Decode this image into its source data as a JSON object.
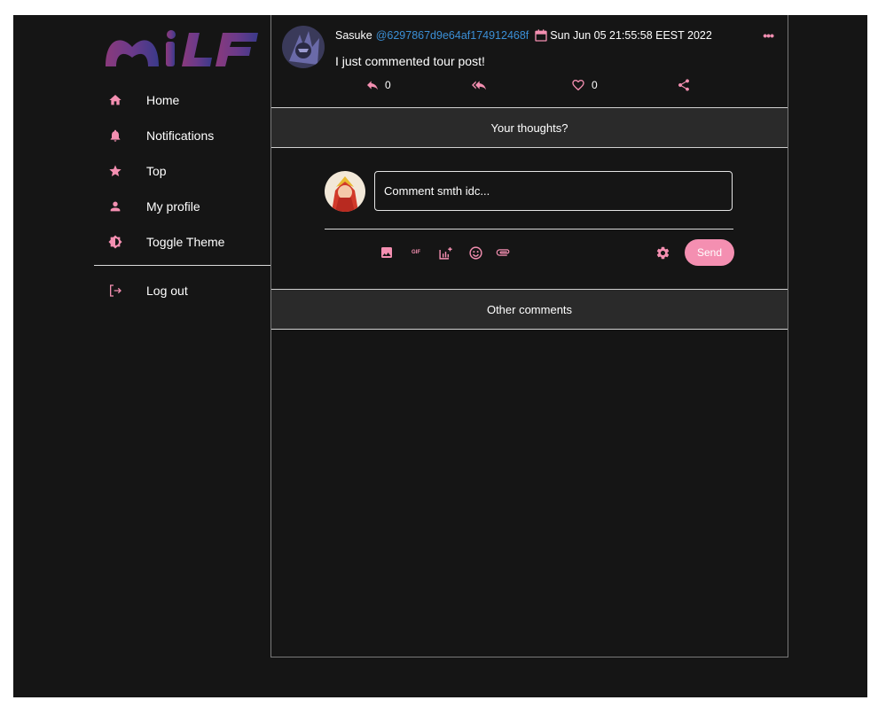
{
  "app": {
    "logo_text": "MiLF",
    "accent_color": "#f48fb1"
  },
  "sidebar": {
    "items": [
      {
        "label": "Home",
        "icon": "home-icon"
      },
      {
        "label": "Notifications",
        "icon": "bell-icon"
      },
      {
        "label": "Top",
        "icon": "star-icon"
      },
      {
        "label": "My profile",
        "icon": "user-icon"
      },
      {
        "label": "Toggle Theme",
        "icon": "theme-icon"
      }
    ],
    "logout": {
      "label": "Log out",
      "icon": "logout-icon"
    }
  },
  "post": {
    "author": "Sasuke",
    "handle": "@6297867d9e64af174912468f",
    "timestamp": "Sun Jun 05 21:55:58 EEST 2022",
    "text": "I just commented tour post!",
    "reply_count": "0",
    "like_count": "0"
  },
  "compose": {
    "section_title": "Your thoughts?",
    "placeholder": "Comment smth idc...",
    "send_label": "Send",
    "gif_label": "GIF"
  },
  "comments": {
    "section_title": "Other comments"
  }
}
